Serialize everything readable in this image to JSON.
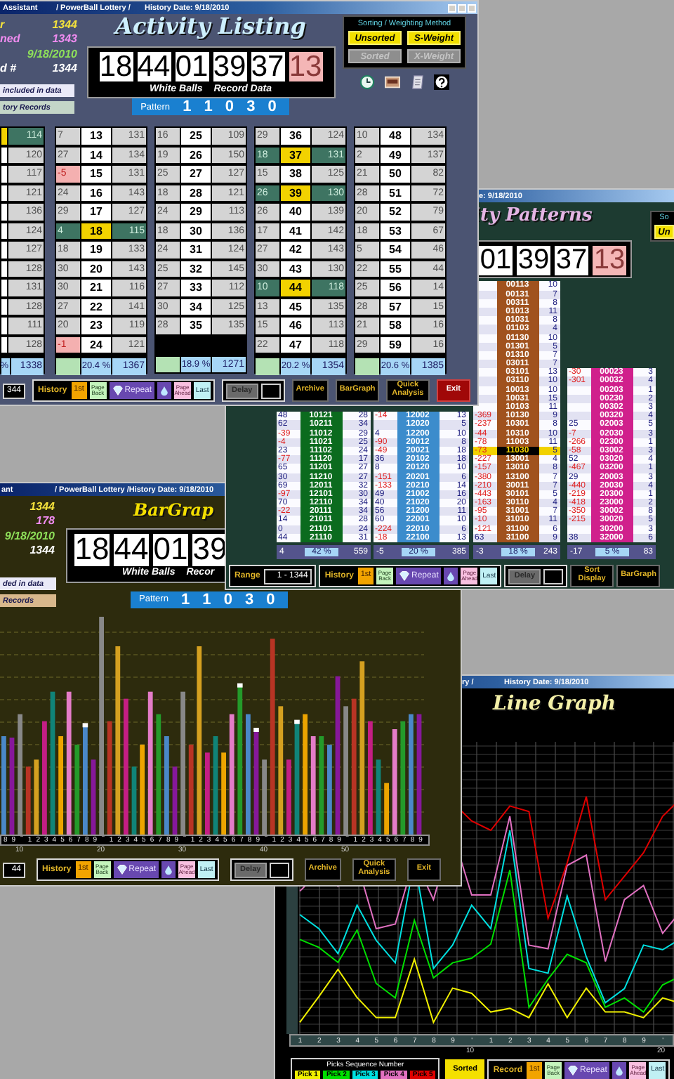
{
  "activity_listing": {
    "title_bar": {
      "app": "Assistant",
      "lottery": "/ PowerBall Lottery /",
      "date": "History Date: 9/18/2010"
    },
    "info": [
      {
        "kind": "records",
        "label": "r",
        "value": "1344"
      },
      {
        "kind": "drawn",
        "label": "ned",
        "value": "1343"
      },
      {
        "kind": "date",
        "value": "9/18/2010"
      },
      {
        "kind": "record",
        "label": "d #",
        "value": "1344"
      }
    ],
    "legend": [
      {
        "kind": "included",
        "text": "included in data"
      },
      {
        "kind": "history",
        "text": "tory Records"
      }
    ],
    "title": "Activity Listing",
    "balls": [
      {
        "value": "18",
        "kind": "white"
      },
      {
        "value": "44",
        "kind": "white"
      },
      {
        "value": "01",
        "kind": "white"
      },
      {
        "value": "39",
        "kind": "white"
      },
      {
        "value": "37",
        "kind": "white"
      },
      {
        "value": "13",
        "kind": "power"
      }
    ],
    "caption": [
      "White Balls",
      "Record Data"
    ],
    "pattern": {
      "label": "Pattern",
      "value": "1 1 0 3 0"
    },
    "sorting": {
      "title": "Sorting / Weighting Method",
      "options": [
        {
          "label": "Unsorted",
          "selected": true
        },
        {
          "label": "S-Weight",
          "selected": true
        },
        {
          "label": "Sorted",
          "selected": false
        },
        {
          "label": "X-Weight",
          "selected": false
        }
      ]
    },
    "columns": [
      {
        "rows": [
          {
            "count": "114",
            "highlighted": true
          },
          {
            "count": "120",
            "highlighted": false
          },
          {
            "count": "117",
            "highlighted": false
          },
          {
            "count": "121",
            "highlighted": false
          },
          {
            "count": "136",
            "highlighted": false
          },
          {
            "count": "124",
            "highlighted": false
          },
          {
            "count": "127",
            "highlighted": false
          },
          {
            "count": "128",
            "highlighted": false
          },
          {
            "count": "131",
            "highlighted": false
          },
          {
            "count": "128",
            "highlighted": false
          },
          {
            "count": "111",
            "highlighted": false
          },
          {
            "count": "128",
            "highlighted": false
          }
        ],
        "footer": {
          "percent": "%",
          "total": "1338"
        }
      },
      {
        "rows": [
          {
            "lag": "7",
            "number": "13",
            "count": "131",
            "highlighted": false,
            "low": false
          },
          {
            "lag": "27",
            "number": "14",
            "count": "134",
            "highlighted": false,
            "low": false
          },
          {
            "lag": "-5",
            "number": "15",
            "count": "131",
            "highlighted": false,
            "low": true
          },
          {
            "lag": "24",
            "number": "16",
            "count": "143",
            "highlighted": false,
            "low": false
          },
          {
            "lag": "29",
            "number": "17",
            "count": "127",
            "highlighted": false,
            "low": false
          },
          {
            "lag": "4",
            "number": "18",
            "count": "115",
            "highlighted": true,
            "low": false
          },
          {
            "lag": "18",
            "number": "19",
            "count": "133",
            "highlighted": false,
            "low": false
          },
          {
            "lag": "30",
            "number": "20",
            "count": "143",
            "highlighted": false,
            "low": false
          },
          {
            "lag": "30",
            "number": "21",
            "count": "116",
            "highlighted": false,
            "low": false
          },
          {
            "lag": "27",
            "number": "22",
            "count": "141",
            "highlighted": false,
            "low": false
          },
          {
            "lag": "20",
            "number": "23",
            "count": "119",
            "highlighted": false,
            "low": false
          },
          {
            "lag": "-1",
            "number": "24",
            "count": "121",
            "highlighted": false,
            "low": true
          }
        ],
        "footer": {
          "percent": "20.4 %",
          "total": "1367"
        }
      },
      {
        "rows": [
          {
            "lag": "16",
            "number": "25",
            "count": "109",
            "highlighted": false,
            "low": false
          },
          {
            "lag": "19",
            "number": "26",
            "count": "150",
            "highlighted": false,
            "low": false
          },
          {
            "lag": "25",
            "number": "27",
            "count": "127",
            "highlighted": false,
            "low": false
          },
          {
            "lag": "18",
            "number": "28",
            "count": "121",
            "highlighted": false,
            "low": false
          },
          {
            "lag": "24",
            "number": "29",
            "count": "113",
            "highlighted": false,
            "low": false
          },
          {
            "lag": "18",
            "number": "30",
            "count": "136",
            "highlighted": false,
            "low": false
          },
          {
            "lag": "24",
            "number": "31",
            "count": "124",
            "highlighted": false,
            "low": false
          },
          {
            "lag": "25",
            "number": "32",
            "count": "145",
            "highlighted": false,
            "low": false
          },
          {
            "lag": "27",
            "number": "33",
            "count": "112",
            "highlighted": false,
            "low": false
          },
          {
            "lag": "30",
            "number": "34",
            "count": "125",
            "highlighted": false,
            "low": false
          },
          {
            "lag": "28",
            "number": "35",
            "count": "135",
            "highlighted": false,
            "low": false
          }
        ],
        "footer": {
          "percent": "18.9 %",
          "total": "1271"
        }
      },
      {
        "rows": [
          {
            "lag": "29",
            "number": "36",
            "count": "124",
            "highlighted": false,
            "low": false
          },
          {
            "lag": "18",
            "number": "37",
            "count": "131",
            "highlighted": true,
            "low": false
          },
          {
            "lag": "15",
            "number": "38",
            "count": "125",
            "highlighted": false,
            "low": false
          },
          {
            "lag": "26",
            "number": "39",
            "count": "130",
            "highlighted": true,
            "low": false
          },
          {
            "lag": "26",
            "number": "40",
            "count": "139",
            "highlighted": false,
            "low": false
          },
          {
            "lag": "17",
            "number": "41",
            "count": "142",
            "highlighted": false,
            "low": false
          },
          {
            "lag": "27",
            "number": "42",
            "count": "143",
            "highlighted": false,
            "low": false
          },
          {
            "lag": "30",
            "number": "43",
            "count": "130",
            "highlighted": false,
            "low": false
          },
          {
            "lag": "10",
            "number": "44",
            "count": "118",
            "highlighted": true,
            "low": false
          },
          {
            "lag": "13",
            "number": "45",
            "count": "135",
            "highlighted": false,
            "low": false
          },
          {
            "lag": "15",
            "number": "46",
            "count": "113",
            "highlighted": false,
            "low": false
          },
          {
            "lag": "22",
            "number": "47",
            "count": "118",
            "highlighted": false,
            "low": false
          }
        ],
        "footer": {
          "percent": "20.2 %",
          "total": "1354"
        }
      },
      {
        "rows": [
          {
            "lag": "10",
            "number": "48",
            "count": "134",
            "highlighted": false,
            "low": false
          },
          {
            "lag": "2",
            "number": "49",
            "count": "137",
            "highlighted": false,
            "low": false
          },
          {
            "lag": "21",
            "number": "50",
            "count": "82",
            "highlighted": false,
            "low": false
          },
          {
            "lag": "28",
            "number": "51",
            "count": "72",
            "highlighted": false,
            "low": false
          },
          {
            "lag": "20",
            "number": "52",
            "count": "79",
            "highlighted": false,
            "low": false
          },
          {
            "lag": "18",
            "number": "53",
            "count": "67",
            "highlighted": false,
            "low": false
          },
          {
            "lag": "5",
            "number": "54",
            "count": "46",
            "highlighted": false,
            "low": false
          },
          {
            "lag": "22",
            "number": "55",
            "count": "44",
            "highlighted": false,
            "low": false
          },
          {
            "lag": "25",
            "number": "56",
            "count": "14",
            "highlighted": false,
            "low": false
          },
          {
            "lag": "28",
            "number": "57",
            "count": "15",
            "highlighted": false,
            "low": false
          },
          {
            "lag": "21",
            "number": "58",
            "count": "16",
            "highlighted": false,
            "low": false
          },
          {
            "lag": "29",
            "number": "59",
            "count": "16",
            "highlighted": false,
            "low": false
          }
        ],
        "footer": {
          "percent": "20.6 %",
          "total": "1385"
        }
      }
    ],
    "toolbar": {
      "range": {
        "value": "344"
      },
      "history": {
        "label": "History",
        "first": "1st",
        "back": "Page Back",
        "repeat": "Repeat",
        "ahead": "Page Ahead",
        "last": "Last"
      },
      "delay": "Delay",
      "buttons": [
        {
          "label": "Archive",
          "kind": "gold"
        },
        {
          "label": "BarGraph",
          "kind": "gold"
        },
        {
          "label": "Quick Analysis",
          "kind": "gold"
        },
        {
          "label": "Exit",
          "kind": "exit"
        }
      ]
    }
  },
  "activity_patterns": {
    "title_bar": {
      "date": "e: 9/18/2010"
    },
    "title": "ity Patterns",
    "sorting": {
      "title": "So",
      "option": "Un",
      "selected": true
    },
    "balls": [
      {
        "value": "01",
        "kind": "white"
      },
      {
        "value": "39",
        "kind": "white"
      },
      {
        "value": "37",
        "kind": "white"
      },
      {
        "value": "13",
        "kind": "power"
      }
    ],
    "columns": [
      {
        "color": "#0b6b1e",
        "rows": [
          {
            "lag": "48",
            "pattern": "10121",
            "count": "28",
            "negative": false,
            "highlighted": false
          },
          {
            "lag": "62",
            "pattern": "10211",
            "count": "34",
            "negative": false,
            "highlighted": false
          },
          {
            "lag": "-39",
            "pattern": "11012",
            "count": "29",
            "negative": true,
            "highlighted": false
          },
          {
            "lag": "-4",
            "pattern": "11021",
            "count": "25",
            "negative": true,
            "highlighted": false
          },
          {
            "lag": "23",
            "pattern": "11102",
            "count": "24",
            "negative": false,
            "highlighted": false
          },
          {
            "lag": "-77",
            "pattern": "11120",
            "count": "17",
            "negative": true,
            "highlighted": false
          },
          {
            "lag": "65",
            "pattern": "11201",
            "count": "27",
            "negative": false,
            "highlighted": false
          },
          {
            "lag": "30",
            "pattern": "11210",
            "count": "27",
            "negative": false,
            "highlighted": false
          },
          {
            "lag": "69",
            "pattern": "12011",
            "count": "32",
            "negative": false,
            "highlighted": false
          },
          {
            "lag": "-97",
            "pattern": "12101",
            "count": "30",
            "negative": true,
            "highlighted": false
          },
          {
            "lag": "70",
            "pattern": "12110",
            "count": "34",
            "negative": false,
            "highlighted": false
          },
          {
            "lag": "-22",
            "pattern": "20111",
            "count": "34",
            "negative": true,
            "highlighted": false
          },
          {
            "lag": "14",
            "pattern": "21011",
            "count": "28",
            "negative": false,
            "highlighted": false
          },
          {
            "lag": "0",
            "pattern": "21101",
            "count": "24",
            "negative": false,
            "highlighted": false
          },
          {
            "lag": "44",
            "pattern": "21110",
            "count": "31",
            "negative": false,
            "highlighted": false
          }
        ],
        "footer": {
          "lag": "4",
          "percent": "42 %",
          "total": "559"
        }
      },
      {
        "color": "#3c8ccc",
        "rows": [
          {
            "lag": "-14",
            "pattern": "12002",
            "count": "13",
            "negative": true,
            "highlighted": false
          },
          {
            "pattern": "12020",
            "count": "5",
            "highlighted": false
          },
          {
            "lag": "4",
            "pattern": "12200",
            "count": "10",
            "negative": false,
            "highlighted": false
          },
          {
            "lag": "-90",
            "pattern": "20012",
            "count": "8",
            "negative": true,
            "highlighted": false
          },
          {
            "lag": "-49",
            "pattern": "20021",
            "count": "18",
            "negative": true,
            "highlighted": false
          },
          {
            "lag": "36",
            "pattern": "20102",
            "count": "18",
            "negative": false,
            "highlighted": false
          },
          {
            "lag": "8",
            "pattern": "20120",
            "count": "10",
            "negative": false,
            "highlighted": false
          },
          {
            "lag": "-151",
            "pattern": "20201",
            "count": "6",
            "negative": true,
            "highlighted": false
          },
          {
            "lag": "-133",
            "pattern": "20210",
            "count": "14",
            "negative": true,
            "highlighted": false
          },
          {
            "lag": "49",
            "pattern": "21002",
            "count": "16",
            "negative": false,
            "highlighted": false
          },
          {
            "lag": "40",
            "pattern": "21020",
            "count": "20",
            "negative": false,
            "highlighted": false
          },
          {
            "lag": "56",
            "pattern": "21200",
            "count": "11",
            "negative": false,
            "highlighted": false
          },
          {
            "lag": "60",
            "pattern": "22001",
            "count": "10",
            "negative": false,
            "highlighted": false
          },
          {
            "lag": "-224",
            "pattern": "22010",
            "count": "6",
            "negative": true,
            "highlighted": false
          },
          {
            "lag": "-18",
            "pattern": "22100",
            "count": "13",
            "negative": true,
            "highlighted": false
          }
        ],
        "footer": {
          "lag": "-5",
          "percent": "20 %",
          "total": "385"
        }
      },
      {
        "color": "#a0521e",
        "rows": [
          {
            "pattern": "00113",
            "count": "10",
            "highlighted": false
          },
          {
            "pattern": "00131",
            "count": "7",
            "highlighted": false
          },
          {
            "pattern": "00311",
            "count": "8",
            "highlighted": false
          },
          {
            "pattern": "01013",
            "count": "11",
            "highlighted": false
          },
          {
            "pattern": "01031",
            "count": "8",
            "highlighted": false
          },
          {
            "pattern": "01103",
            "count": "4",
            "highlighted": false
          },
          {
            "pattern": "01130",
            "count": "10",
            "highlighted": false
          },
          {
            "pattern": "01301",
            "count": "5",
            "highlighted": false
          },
          {
            "pattern": "01310",
            "count": "7",
            "highlighted": false
          },
          {
            "pattern": "03011",
            "count": "7",
            "highlighted": false
          },
          {
            "pattern": "03101",
            "count": "13",
            "highlighted": false
          },
          {
            "pattern": "03110",
            "count": "10",
            "highlighted": false
          },
          {
            "pattern": "10013",
            "count": "10",
            "highlighted": false
          },
          {
            "pattern": "10031",
            "count": "15",
            "highlighted": false
          },
          {
            "pattern": "10103",
            "count": "11",
            "highlighted": false
          },
          {
            "lag": "-369",
            "pattern": "10130",
            "count": "9",
            "negative": true,
            "highlighted": false
          },
          {
            "lag": "-237",
            "pattern": "10301",
            "count": "8",
            "negative": true,
            "highlighted": false
          },
          {
            "lag": "-44",
            "pattern": "10310",
            "count": "10",
            "negative": true,
            "highlighted": false
          },
          {
            "lag": "-78",
            "pattern": "11003",
            "count": "11",
            "negative": true,
            "highlighted": false
          },
          {
            "lag": "-73",
            "pattern": "11030",
            "count": "5",
            "negative": true,
            "highlighted": true
          },
          {
            "lag": "-227",
            "pattern": "13001",
            "count": "4",
            "negative": true,
            "highlighted": false
          },
          {
            "lag": "-157",
            "pattern": "13010",
            "count": "8",
            "negative": true,
            "highlighted": false
          },
          {
            "lag": "-380",
            "pattern": "13100",
            "count": "7",
            "negative": true,
            "highlighted": false
          },
          {
            "lag": "-210",
            "pattern": "30011",
            "count": "7",
            "negative": true,
            "highlighted": false
          },
          {
            "lag": "-443",
            "pattern": "30101",
            "count": "5",
            "negative": true,
            "highlighted": false
          },
          {
            "lag": "-163",
            "pattern": "30110",
            "count": "4",
            "negative": true,
            "highlighted": false
          },
          {
            "lag": "-95",
            "pattern": "31001",
            "count": "7",
            "negative": true,
            "highlighted": false
          },
          {
            "lag": "-10",
            "pattern": "31010",
            "count": "11",
            "negative": true,
            "highlighted": false
          },
          {
            "lag": "-121",
            "pattern": "31100",
            "count": "6",
            "negative": true,
            "highlighted": false
          },
          {
            "lag": "63",
            "pattern": "31100",
            "count": "9",
            "negative": false,
            "highlighted": false
          }
        ],
        "footer": {
          "lag": "-3",
          "percent": "18 %",
          "total": "243"
        }
      },
      {
        "color": "#d0208c",
        "rows": [
          {
            "lag": "-30",
            "pattern": "00023",
            "count": "3",
            "negative": true,
            "highlighted": false
          },
          {
            "lag": "-301",
            "pattern": "00032",
            "count": "4",
            "negative": true,
            "highlighted": false
          },
          {
            "pattern": "00203",
            "count": "1",
            "highlighted": false
          },
          {
            "pattern": "00230",
            "count": "2",
            "highlighted": false
          },
          {
            "pattern": "00302",
            "count": "3",
            "highlighted": false
          },
          {
            "pattern": "00320",
            "count": "4",
            "highlighted": false
          },
          {
            "lag": "25",
            "pattern": "02003",
            "count": "5",
            "negative": false,
            "highlighted": false
          },
          {
            "lag": "-7",
            "pattern": "02030",
            "count": "3",
            "negative": true,
            "highlighted": false
          },
          {
            "lag": "-266",
            "pattern": "02300",
            "count": "1",
            "negative": true,
            "highlighted": false
          },
          {
            "lag": "-58",
            "pattern": "03002",
            "count": "3",
            "negative": true,
            "highlighted": false
          },
          {
            "lag": "52",
            "pattern": "03020",
            "count": "4",
            "negative": false,
            "highlighted": false
          },
          {
            "lag": "-467",
            "pattern": "03200",
            "count": "1",
            "negative": true,
            "highlighted": false
          },
          {
            "lag": "29",
            "pattern": "20003",
            "count": "3",
            "negative": false,
            "highlighted": false
          },
          {
            "lag": "-440",
            "pattern": "20030",
            "count": "4",
            "negative": true,
            "highlighted": false
          },
          {
            "lag": "-219",
            "pattern": "20300",
            "count": "1",
            "negative": true,
            "highlighted": false
          },
          {
            "lag": "-418",
            "pattern": "23000",
            "count": "2",
            "negative": true,
            "highlighted": false
          },
          {
            "lag": "-350",
            "pattern": "30002",
            "count": "8",
            "negative": true,
            "highlighted": false
          },
          {
            "lag": "-215",
            "pattern": "30020",
            "count": "5",
            "negative": true,
            "highlighted": false
          },
          {
            "pattern": "30200",
            "count": "3",
            "highlighted": false
          },
          {
            "lag": "38",
            "pattern": "32000",
            "count": "6",
            "negative": false,
            "highlighted": false
          }
        ],
        "footer": {
          "lag": "-17",
          "percent": "5 %",
          "total": "83"
        }
      }
    ],
    "toolbar": {
      "range": {
        "label": "Range",
        "value": "1 - 1344"
      },
      "history": {
        "label": "History",
        "first": "1st",
        "back": "Page Back",
        "repeat": "Repeat",
        "ahead": "Page Ahead",
        "last": "Last"
      },
      "delay": "Delay",
      "buttons": [
        {
          "label": "Sort Display",
          "kind": "gold"
        },
        {
          "label": "BarGraph",
          "kind": "gold"
        }
      ]
    }
  },
  "bar_graph": {
    "title_bar": {
      "app": "ant",
      "lottery": "/ PowerBall Lottery /",
      "date": "History Date: 9/18/2010"
    },
    "info": [
      {
        "kind": "records",
        "value": "1344"
      },
      {
        "kind": "drawn",
        "value": "178"
      },
      {
        "kind": "date",
        "value": "9/18/2010"
      },
      {
        "kind": "record",
        "value": "1344"
      }
    ],
    "legend": [
      {
        "kind": "included",
        "text": "ded in data"
      },
      {
        "kind": "records",
        "text": "Records"
      }
    ],
    "title": "BarGrap",
    "balls": [
      {
        "value": "18",
        "kind": "white"
      },
      {
        "value": "44",
        "kind": "white"
      },
      {
        "value": "01",
        "kind": "white"
      },
      {
        "value": "39",
        "kind": "white"
      }
    ],
    "caption": [
      "White Balls",
      "Recor"
    ],
    "pattern": {
      "label": "Pattern",
      "value": "1 1 0 3 0"
    },
    "x_ticks": [
      "8",
      "9",
      "‾",
      "1",
      "2",
      "3",
      "4",
      "5",
      "6",
      "7",
      "8",
      "9",
      "‾",
      "1",
      "2",
      "3",
      "4",
      "5",
      "6",
      "7",
      "8",
      "9",
      "‾",
      "1",
      "2",
      "3",
      "4",
      "5",
      "6",
      "7",
      "8",
      "9",
      "‾",
      "1",
      "2",
      "3",
      "4",
      "5",
      "6",
      "7",
      "8",
      "9",
      "‾",
      "1",
      "2",
      "3",
      "4",
      "5",
      "6",
      "7",
      "8",
      "9"
    ],
    "decades": [
      "10",
      "20",
      "30",
      "40",
      "50"
    ],
    "toolbar": {
      "range": {
        "value": "44"
      },
      "history": {
        "label": "History",
        "first": "1st",
        "back": "Page Back",
        "repeat": "Repeat",
        "ahead": "Page Ahead",
        "last": "Last"
      },
      "delay": "Delay",
      "buttons": [
        {
          "label": "Archive",
          "kind": "gold"
        },
        {
          "label": "Quick Analysis",
          "kind": "gold"
        },
        {
          "label": "Exit",
          "kind": "gold"
        }
      ]
    }
  },
  "line_graph": {
    "title_bar": {
      "lottery": "ry /",
      "date": "History Date: 9/18/2010"
    },
    "title": "Line Graph",
    "x_ticks": [
      "1",
      "2",
      "3",
      "4",
      "5",
      "6",
      "7",
      "8",
      "9",
      "'",
      "1",
      "2",
      "3",
      "4",
      "5",
      "6",
      "7",
      "8",
      "9",
      "'"
    ],
    "decades": [
      "10",
      "20"
    ],
    "legend": {
      "title": "Picks Sequence Number",
      "picks": [
        {
          "label": "Pick 1",
          "color": "#f0f000"
        },
        {
          "label": "Pick 2",
          "color": "#00e000"
        },
        {
          "label": "Pick 3",
          "color": "#00e0e0"
        },
        {
          "label": "Pick 4",
          "color": "#e070c0"
        },
        {
          "label": "Pick 5",
          "color": "#e00000"
        }
      ]
    },
    "toolbar": {
      "lead": [
        {
          "label": "Sorted",
          "kind": "sorted"
        }
      ],
      "history": {
        "label": "Record",
        "first": "1st",
        "back": "Page Back",
        "repeat": "Repeat",
        "ahead": "Page Ahead",
        "last": "Last"
      }
    }
  }
}
